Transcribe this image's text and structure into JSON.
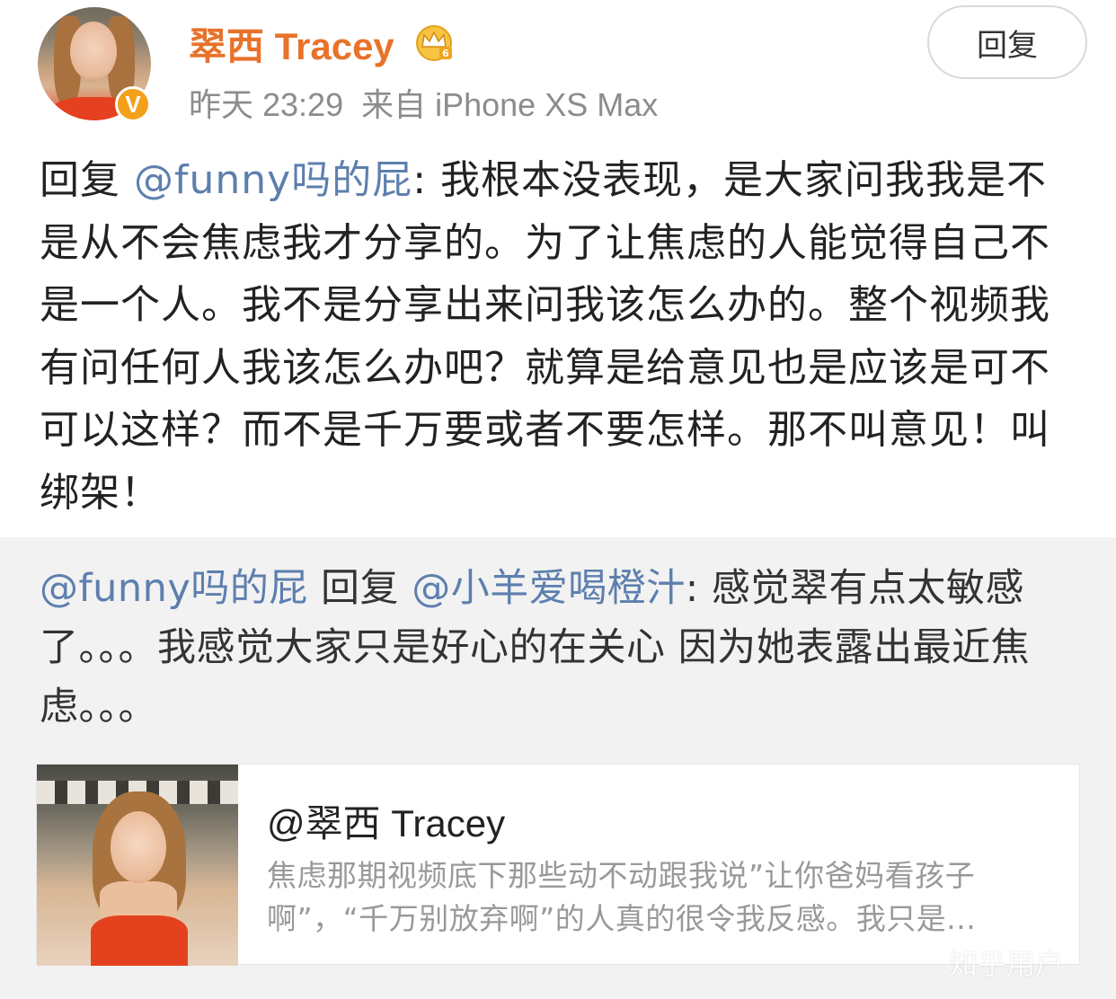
{
  "post": {
    "username": "翠西 Tracey",
    "verified_badge": "V",
    "timestamp": "昨天 23:29",
    "source": "来自 iPhone XS Max",
    "reply_button_label": "回复",
    "text": {
      "prefix": "回复",
      "mention": "@funny吗的屁",
      "body": ": 我根本没表现，是大家问我我是不是从不会焦虑我才分享的。为了让焦虑的人能觉得自己不是一个人。我不是分享出来问我该怎么办的。整个视频我有问任何人我该怎么办吧？就算是给意见也是应该是可不可以这样？而不是千万要或者不要怎样。那不叫意见！叫绑架！"
    }
  },
  "quoted": {
    "author_mention": "@funny吗的屁",
    "reply_word": " 回复 ",
    "target_mention": "@小羊爱喝橙汁",
    "body": ": 感觉翠有点太敏感了。。。我感觉大家只是好心的在关心 因为她表露出最近焦虑。。。",
    "card": {
      "title": "@翠西 Tracey",
      "desc_line1": "焦虑那期视频底下那些动不动跟我说”让你爸妈看孩子",
      "desc_line2": "啊”，“千万别放弃啊”的人真的很令我反感。我只是..."
    }
  },
  "watermark": "知乎用户",
  "icons": {
    "crown": "crown-membership-icon",
    "verified": "verified-v-icon"
  },
  "colors": {
    "username": "#e8722a",
    "link": "#5d7fae",
    "badge": "#f4a01a",
    "quoted_bg": "#f2f2f2"
  }
}
